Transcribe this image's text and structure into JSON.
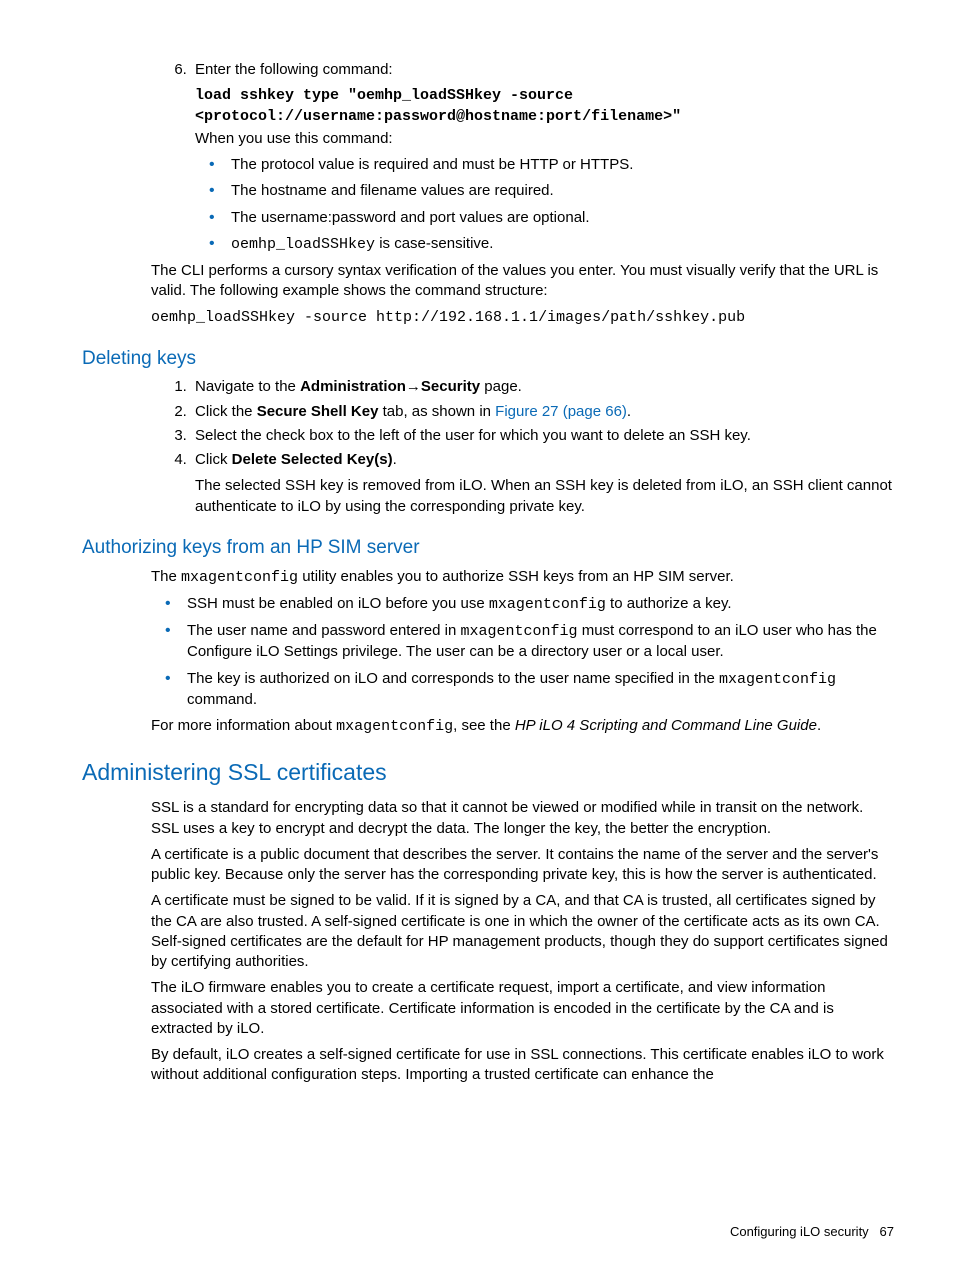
{
  "step6": {
    "num_text": "Enter the following command:",
    "cmd_line1": "load sshkey type \"oemhp_loadSSHkey -source",
    "cmd_line2": "<protocol://username:password@hostname:port/filename>\"",
    "when_you_use": "When you use this command:",
    "bullets": {
      "b1": "The protocol value is required and must be HTTP or HTTPS.",
      "b2": "The hostname and filename values are required.",
      "b3": "The username:password and port values are optional.",
      "b4_code": "oemhp_loadSSHkey",
      "b4_rest": " is case-sensitive."
    }
  },
  "cli_para": "The CLI performs a cursory syntax verification of the values you enter. You must visually verify that the URL is valid. The following example shows the command structure:",
  "cli_example": "oemhp_loadSSHkey -source http://192.168.1.1/images/path/sshkey.pub",
  "deleting": {
    "heading": "Deleting keys",
    "s1_pre": "Navigate to the ",
    "s1_b1": "Administration",
    "s1_arrow": "→",
    "s1_b2": "Security",
    "s1_post": " page.",
    "s2_pre": "Click the ",
    "s2_b": "Secure Shell Key",
    "s2_mid": " tab, as shown in ",
    "s2_link": "Figure 27 (page 66)",
    "s2_post": ".",
    "s3": "Select the check box to the left of the user for which you want to delete an SSH key.",
    "s4_pre": "Click ",
    "s4_b": "Delete Selected Key(s)",
    "s4_post": ".",
    "s4_para": "The selected SSH key is removed from iLO. When an SSH key is deleted from iLO, an SSH client cannot authenticate to iLO by using the corresponding private key."
  },
  "authorizing": {
    "heading": "Authorizing keys from an HP SIM server",
    "intro_pre": "The ",
    "intro_code": "mxagentconfig",
    "intro_post": " utility enables you to authorize SSH keys from an HP SIM server.",
    "b1_pre": "SSH must be enabled on iLO before you use ",
    "b1_code": "mxagentconfig",
    "b1_post": " to authorize a key.",
    "b2_pre": "The user name and password entered in ",
    "b2_code": "mxagentconfig",
    "b2_post": " must correspond to an iLO user who has the Configure iLO Settings privilege. The user can be a directory user or a local user.",
    "b3_pre": "The key is authorized on iLO and corresponds to the user name specified in the ",
    "b3_code": "mxagentconfig",
    "b3_post": " command.",
    "more_pre": "For more information about ",
    "more_code": "mxagentconfig",
    "more_mid": ", see the ",
    "more_italic": "HP iLO 4 Scripting and Command Line Guide",
    "more_post": "."
  },
  "ssl": {
    "heading": "Administering SSL certificates",
    "p1": "SSL is a standard for encrypting data so that it cannot be viewed or modified while in transit on the network. SSL uses a key to encrypt and decrypt the data. The longer the key, the better the encryption.",
    "p2": "A certificate is a public document that describes the server. It contains the name of the server and the server's public key. Because only the server has the corresponding private key, this is how the server is authenticated.",
    "p3": "A certificate must be signed to be valid. If it is signed by a CA, and that CA is trusted, all certificates signed by the CA are also trusted. A self-signed certificate is one in which the owner of the certificate acts as its own CA. Self-signed certificates are the default for HP management products, though they do support certificates signed by certifying authorities.",
    "p4": "The iLO firmware enables you to create a certificate request, import a certificate, and view information associated with a stored certificate. Certificate information is encoded in the certificate by the CA and is extracted by iLO.",
    "p5": "By default, iLO creates a self-signed certificate for use in SSL connections. This certificate enables iLO to work without additional configuration steps. Importing a trusted certificate can enhance the"
  },
  "footer": {
    "text": "Configuring iLO security",
    "page": "67"
  }
}
